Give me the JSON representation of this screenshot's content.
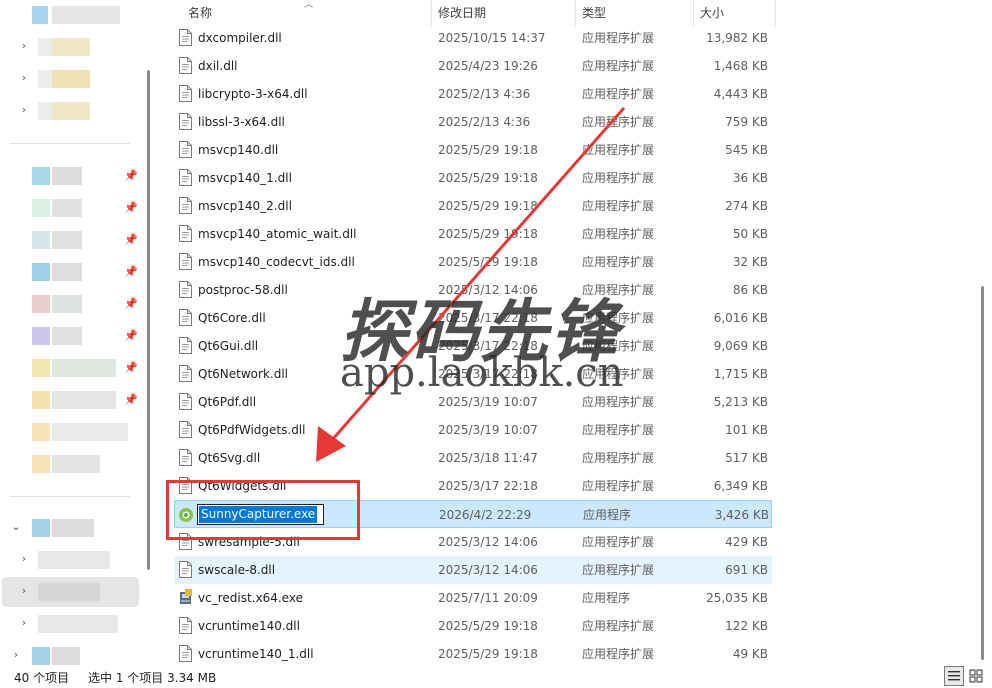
{
  "columns": {
    "name": "名称",
    "date": "修改日期",
    "type": "类型",
    "size": "大小"
  },
  "files": [
    {
      "name": "dxcompiler.dll",
      "date": "2025/10/15 14:37",
      "type": "应用程序扩展",
      "size": "13,982 KB",
      "icon": "dll-file-icon"
    },
    {
      "name": "dxil.dll",
      "date": "2025/4/23 19:26",
      "type": "应用程序扩展",
      "size": "1,468 KB",
      "icon": "dll-file-icon"
    },
    {
      "name": "libcrypto-3-x64.dll",
      "date": "2025/2/13 4:36",
      "type": "应用程序扩展",
      "size": "4,443 KB",
      "icon": "dll-file-icon"
    },
    {
      "name": "libssl-3-x64.dll",
      "date": "2025/2/13 4:36",
      "type": "应用程序扩展",
      "size": "759 KB",
      "icon": "dll-file-icon"
    },
    {
      "name": "msvcp140.dll",
      "date": "2025/5/29 19:18",
      "type": "应用程序扩展",
      "size": "545 KB",
      "icon": "dll-file-icon"
    },
    {
      "name": "msvcp140_1.dll",
      "date": "2025/5/29 19:18",
      "type": "应用程序扩展",
      "size": "36 KB",
      "icon": "dll-file-icon"
    },
    {
      "name": "msvcp140_2.dll",
      "date": "2025/5/29 19:18",
      "type": "应用程序扩展",
      "size": "274 KB",
      "icon": "dll-file-icon"
    },
    {
      "name": "msvcp140_atomic_wait.dll",
      "date": "2025/5/29 19:18",
      "type": "应用程序扩展",
      "size": "50 KB",
      "icon": "dll-file-icon"
    },
    {
      "name": "msvcp140_codecvt_ids.dll",
      "date": "2025/5/29 19:18",
      "type": "应用程序扩展",
      "size": "32 KB",
      "icon": "dll-file-icon"
    },
    {
      "name": "postproc-58.dll",
      "date": "2025/3/12 14:06",
      "type": "应用程序扩展",
      "size": "86 KB",
      "icon": "dll-file-icon"
    },
    {
      "name": "Qt6Core.dll",
      "date": "2025/3/17 22:18",
      "type": "应用程序扩展",
      "size": "6,016 KB",
      "icon": "dll-file-icon"
    },
    {
      "name": "Qt6Gui.dll",
      "date": "2025/3/17 22:18",
      "type": "应用程序扩展",
      "size": "9,069 KB",
      "icon": "dll-file-icon"
    },
    {
      "name": "Qt6Network.dll",
      "date": "2025/3/17 22:18",
      "type": "应用程序扩展",
      "size": "1,715 KB",
      "icon": "dll-file-icon"
    },
    {
      "name": "Qt6Pdf.dll",
      "date": "2025/3/19 10:07",
      "type": "应用程序扩展",
      "size": "5,213 KB",
      "icon": "dll-file-icon"
    },
    {
      "name": "Qt6PdfWidgets.dll",
      "date": "2025/3/19 10:07",
      "type": "应用程序扩展",
      "size": "101 KB",
      "icon": "dll-file-icon"
    },
    {
      "name": "Qt6Svg.dll",
      "date": "2025/3/18 11:47",
      "type": "应用程序扩展",
      "size": "517 KB",
      "icon": "dll-file-icon"
    },
    {
      "name": "Qt6Widgets.dll",
      "date": "2025/3/17 22:18",
      "type": "应用程序扩展",
      "size": "6,349 KB",
      "icon": "dll-file-icon"
    },
    {
      "name": "SunnyCapturer.exe",
      "date": "2026/4/2 22:29",
      "type": "应用程序",
      "size": "3,426 KB",
      "icon": "app-exe-icon",
      "selected": true,
      "renaming": true
    },
    {
      "name": "swresample-5.dll",
      "date": "2025/3/12 14:06",
      "type": "应用程序扩展",
      "size": "429 KB",
      "icon": "dll-file-icon"
    },
    {
      "name": "swscale-8.dll",
      "date": "2025/3/12 14:06",
      "type": "应用程序扩展",
      "size": "691 KB",
      "icon": "dll-file-icon",
      "hover": true
    },
    {
      "name": "vc_redist.x64.exe",
      "date": "2025/7/11 20:09",
      "type": "应用程序",
      "size": "25,035 KB",
      "icon": "installer-exe-icon"
    },
    {
      "name": "vcruntime140.dll",
      "date": "2025/5/29 19:18",
      "type": "应用程序扩展",
      "size": "122 KB",
      "icon": "dll-file-icon"
    },
    {
      "name": "vcruntime140_1.dll",
      "date": "2025/5/29 19:18",
      "type": "应用程序扩展",
      "size": "49 KB",
      "icon": "dll-file-icon"
    }
  ],
  "status": {
    "item_count": "40 个项目",
    "selection": "选中 1 个项目  3.34 MB"
  },
  "watermark": {
    "title": "探码先锋",
    "url": "app.laokbk.cn"
  },
  "colors": {
    "selection_bg": "#cce8ff",
    "selection_border": "#99d1ff",
    "hover_bg": "#e5f3ff",
    "annotation_red": "#e53935",
    "rename_highlight": "#0078d7"
  }
}
